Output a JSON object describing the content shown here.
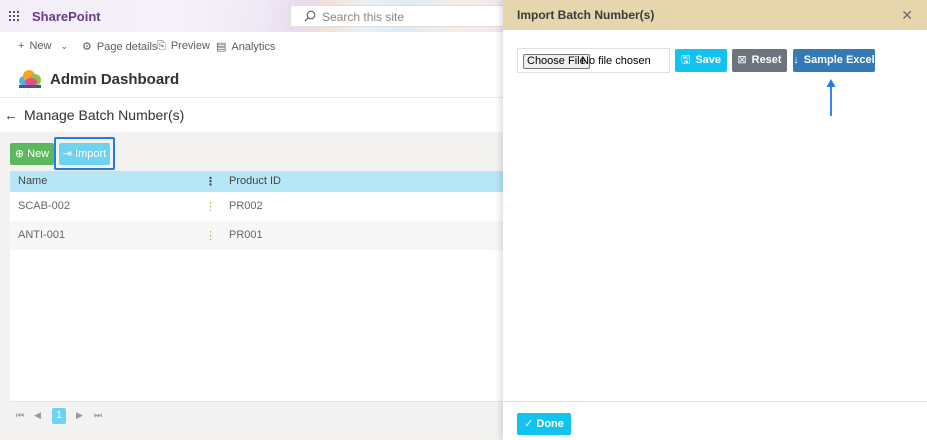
{
  "suitebar": {
    "brand": "SharePoint",
    "search_placeholder": "Search this site"
  },
  "commandbar": {
    "new_label": "New",
    "page_details_label": "Page details",
    "preview_label": "Preview",
    "analytics_label": "Analytics"
  },
  "site": {
    "title": "Admin Dashboard"
  },
  "page": {
    "heading": "Manage Batch Number(s)"
  },
  "toolbar": {
    "new_label": "New",
    "import_label": "Import"
  },
  "grid": {
    "columns": [
      "Name",
      "Product ID"
    ],
    "rows": [
      {
        "name": "SCAB-002",
        "product_id": "PR002"
      },
      {
        "name": "ANTI-001",
        "product_id": "PR001"
      }
    ],
    "current_page": "1"
  },
  "panel": {
    "title": "Import Batch Number(s)",
    "choose_file_label": "Choose File",
    "no_file_text": "No file chosen",
    "save_label": "Save",
    "reset_label": "Reset",
    "sample_excel_label": "Sample Excel",
    "done_label": "Done"
  },
  "colors": {
    "panel_header": "#e6d6ad",
    "primary_cyan": "#13c3ef",
    "sample_blue": "#337ab7",
    "reset_gray": "#6c757d",
    "new_green": "#5cb85c",
    "grid_header": "#b7e7f7",
    "highlight_blue": "#1f7ce8"
  }
}
